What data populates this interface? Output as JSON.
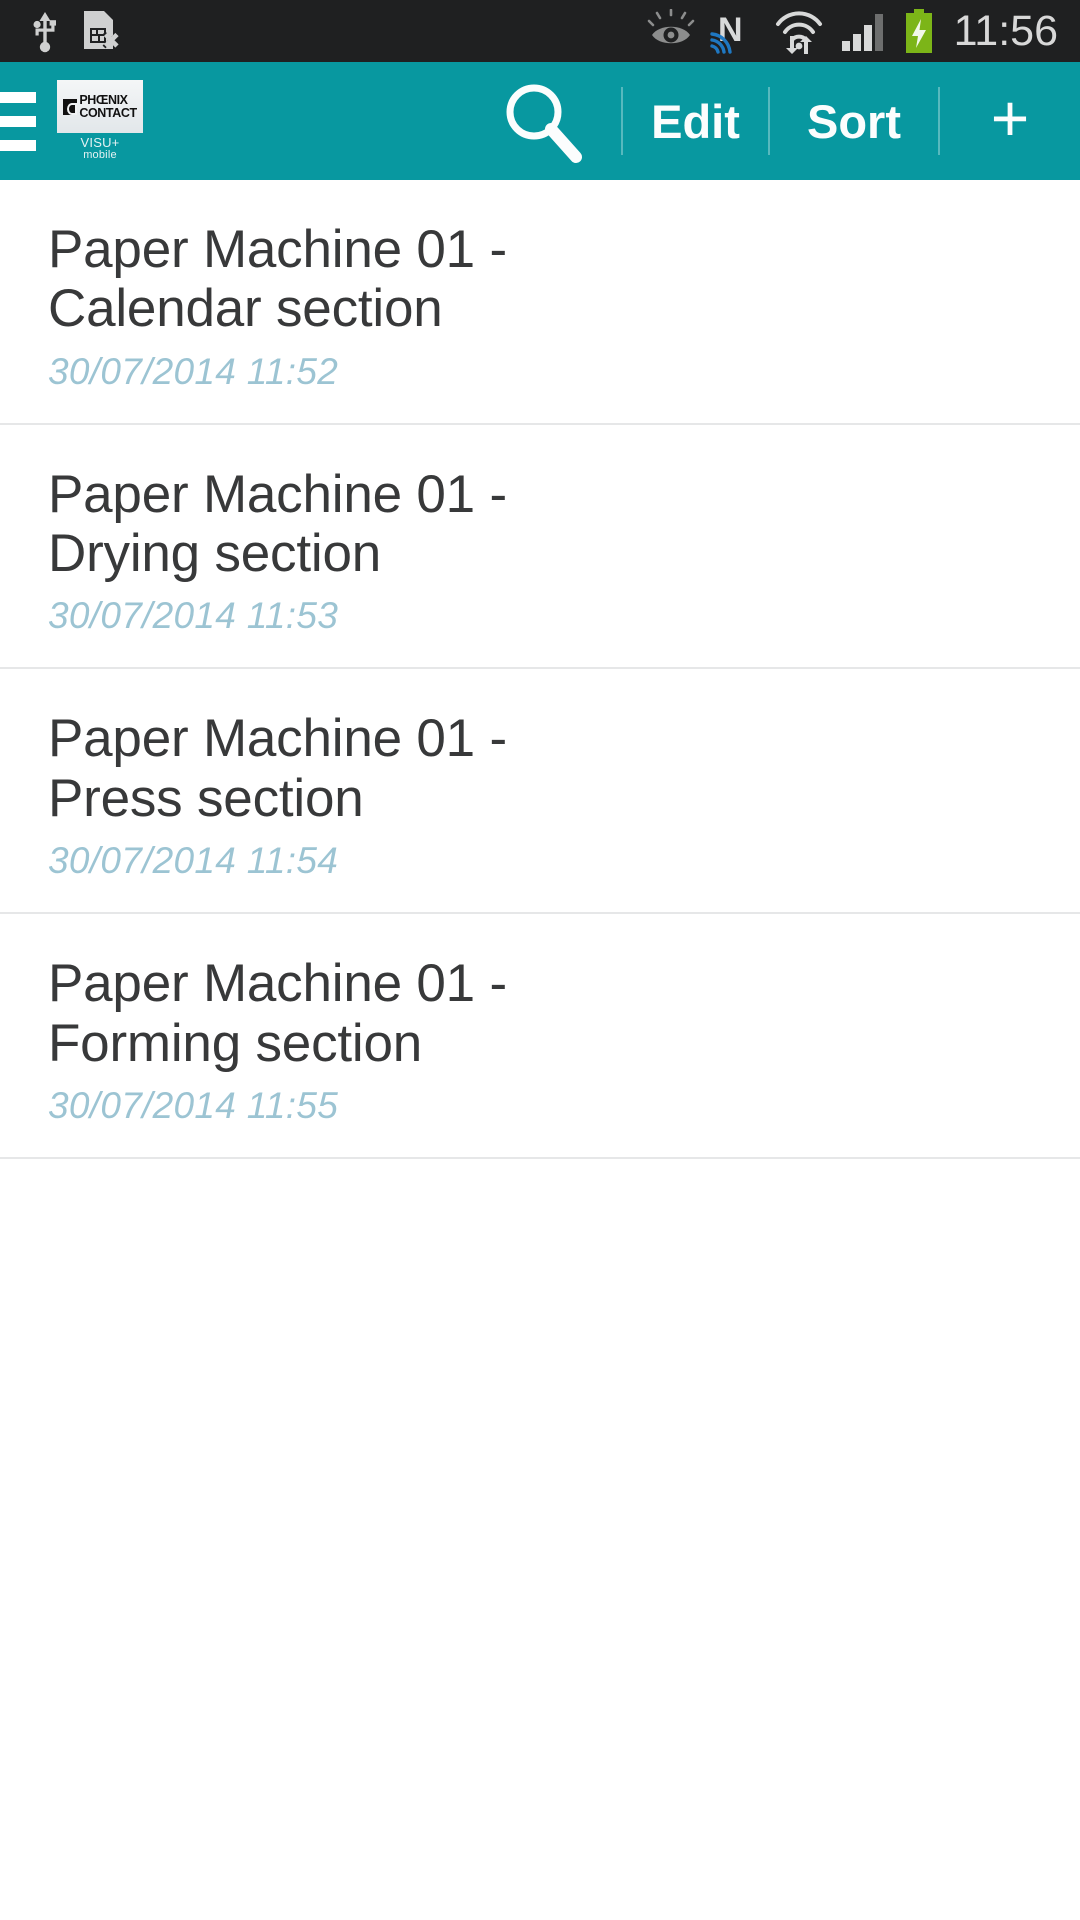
{
  "status_bar": {
    "background": "#1f2021",
    "clock": "11:56",
    "icons_left": [
      "usb-icon",
      "sim-card-removed-icon"
    ],
    "icons_right": [
      "smart-stay-eye-icon",
      "nfc-icon",
      "wifi-transfer-icon",
      "cellular-signal-icon",
      "battery-charging-icon"
    ],
    "battery_color": "#7cb518"
  },
  "app_bar": {
    "background": "#0898a0",
    "drawer_icon": "hamburger-menu-icon",
    "brand": {
      "logo_text_line1": "PHŒNIX",
      "logo_text_line2": "CONTACT",
      "sub_line1": "VISU+",
      "sub_line2": "mobile"
    },
    "actions": {
      "search_icon": "search-icon",
      "edit_label": "Edit",
      "sort_label": "Sort",
      "add_label": "+"
    }
  },
  "list": {
    "items": [
      {
        "title": "Paper Machine 01 - Calendar section",
        "timestamp": "30/07/2014  11:52"
      },
      {
        "title": "Paper Machine 01 - Drying section",
        "timestamp": "30/07/2014  11:53"
      },
      {
        "title": "Paper Machine 01 - Press section",
        "timestamp": "30/07/2014  11:54"
      },
      {
        "title": "Paper Machine 01 - Forming section",
        "timestamp": "30/07/2014  11:55"
      }
    ]
  },
  "colors": {
    "accent_teal": "#0898a0",
    "title_text": "#38393a",
    "timestamp_text": "#9cc4d3",
    "divider": "#e6e7e8"
  }
}
